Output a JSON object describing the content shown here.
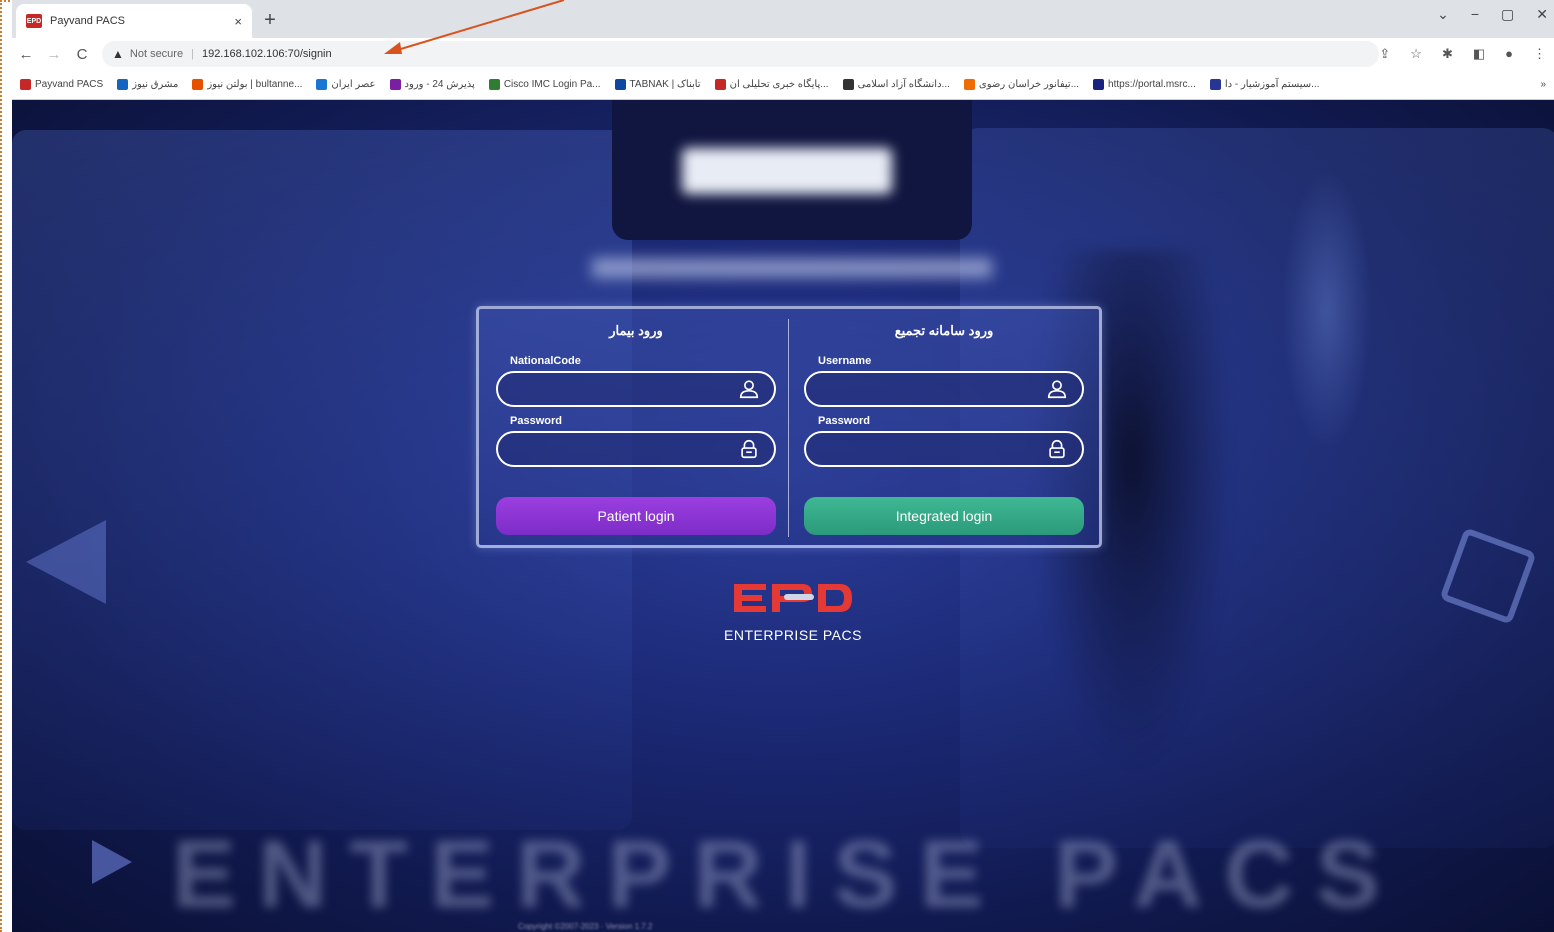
{
  "browser": {
    "tab_title": "Payvand PACS",
    "tab_close": "×",
    "new_tab": "+",
    "window_controls": [
      "⌄",
      "−",
      "▢",
      "✕"
    ],
    "nav": {
      "back": "←",
      "forward": "→",
      "reload": "C"
    },
    "security_warning": "Not secure",
    "url": "192.168.102.106:70/signin",
    "toolbar_icons": [
      "share-icon",
      "star-icon",
      "extensions-icon",
      "sidebar-icon",
      "profile-icon",
      "menu-icon"
    ]
  },
  "bookmarks": [
    {
      "label": "Payvand PACS",
      "color": "#c62828"
    },
    {
      "label": "مشرق نیوز",
      "color": "#1565c0"
    },
    {
      "label": "بولتن نیوز | bultanne...",
      "color": "#e65100"
    },
    {
      "label": "عصر ایران",
      "color": "#1976d2"
    },
    {
      "label": "پذیرش 24 - ورود",
      "color": "#7b1fa2"
    },
    {
      "label": "Cisco IMC Login Pa...",
      "color": "#2e7d32"
    },
    {
      "label": "TABNAK | تابناک",
      "color": "#0d47a1"
    },
    {
      "label": "پایگاه خبری تحلیلی ان...",
      "color": "#c62828"
    },
    {
      "label": "دانشگاه آزاد اسلامی...",
      "color": "#333333"
    },
    {
      "label": "تیفانور خراسان رضوی...",
      "color": "#ef6c00"
    },
    {
      "label": "https://portal.msrc...",
      "color": "#1a237e"
    },
    {
      "label": "سیستم آموزشیار - دا...",
      "color": "#283593"
    }
  ],
  "bookmarks_overflow": "»",
  "login": {
    "patient": {
      "title": "ورود بیمار",
      "id_label": "NationalCode",
      "password_label": "Password",
      "button": "Patient login"
    },
    "integrated": {
      "title": "ورود سامانه تجمیع",
      "id_label": "Username",
      "password_label": "Password",
      "button": "Integrated login"
    }
  },
  "brand": {
    "text": "ENTERPRISE PACS",
    "colors": {
      "logo": "#e53935",
      "patient_button": "#8e35d6",
      "integrated_button": "#35aa88"
    }
  },
  "footer": {
    "watermark": "ENTERPRISE PACS"
  }
}
